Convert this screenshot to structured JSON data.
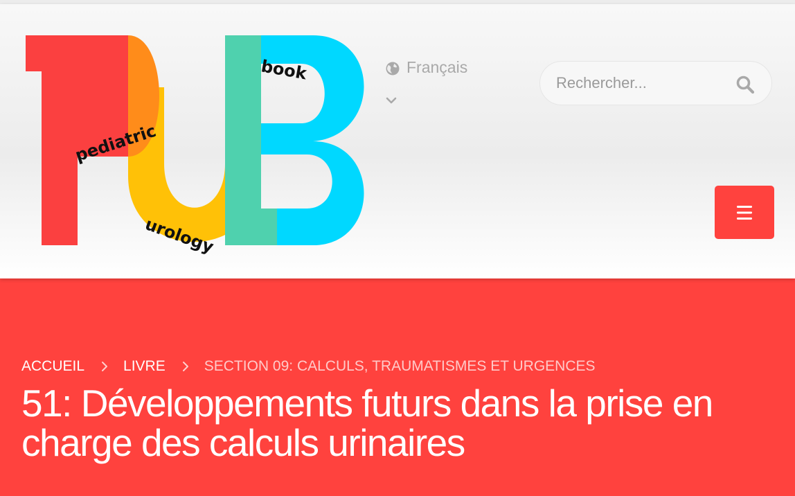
{
  "logo": {
    "alt": "PUB pediatric urology book",
    "word_pediatric": "pediatric",
    "word_urology": "urology",
    "word_book": "book",
    "colors": {
      "p": "#fb4040",
      "p_bowl": "#ff8c1a",
      "u": "#ffc107",
      "b_stem": "#4fd1ae",
      "b_bowls": "#00d8ff"
    }
  },
  "language": {
    "label": "Français",
    "icon": "globe-icon",
    "dropdown_icon": "chevron-down-icon"
  },
  "search": {
    "placeholder": "Rechercher...",
    "icon": "search-icon"
  },
  "menu": {
    "icon": "hamburger-icon"
  },
  "breadcrumb": {
    "items": [
      "ACCUEIL",
      "LIVRE",
      "SECTION 09: CALCULS, TRAUMATISMES ET URGENCES"
    ]
  },
  "page": {
    "title": "51: Développements futurs dans la prise en charge des calculs urinaires"
  },
  "colors": {
    "accent": "#ff423e",
    "header_bg": "#f2f2f2",
    "muted_text": "#a9a9a9"
  }
}
